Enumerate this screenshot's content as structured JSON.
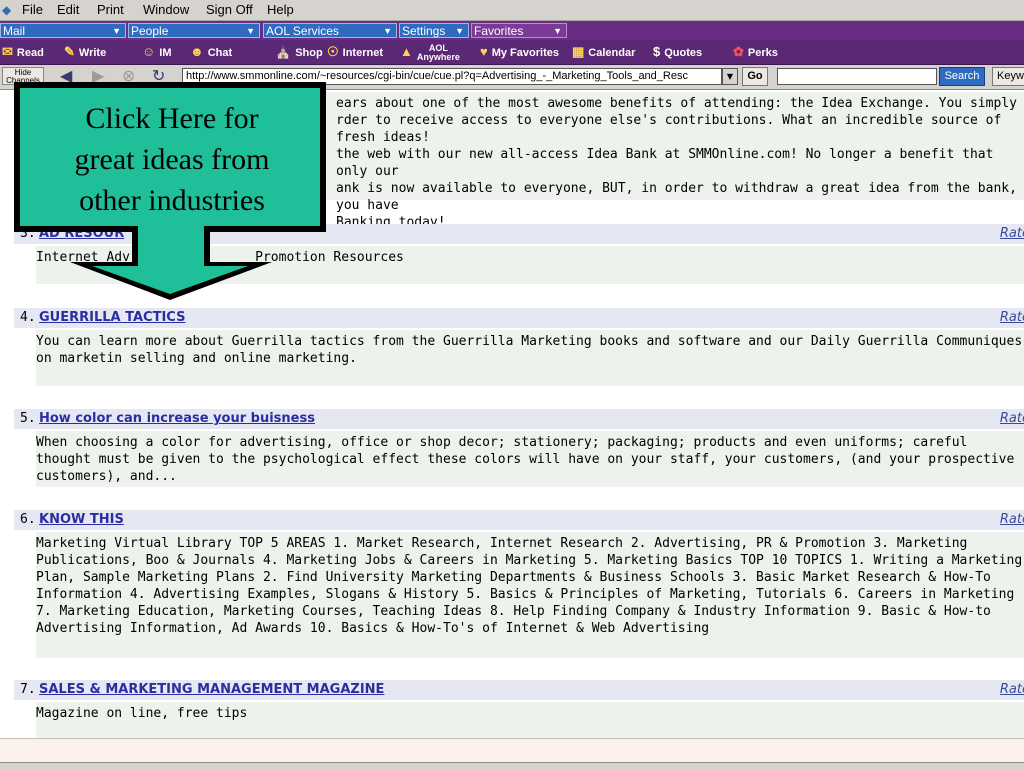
{
  "menu": [
    "File",
    "Edit",
    "Print",
    "Window",
    "Sign Off",
    "Help"
  ],
  "channels": [
    "Mail",
    "People",
    "AOL Services",
    "Settings",
    "Favorites"
  ],
  "toolbar": {
    "read": "Read",
    "write": "Write",
    "im": "IM",
    "chat": "Chat",
    "shop": "Shop",
    "internet": "Internet",
    "aol_anywhere_1": "AOL",
    "aol_anywhere_2": "Anywhere",
    "my_favorites": "My Favorites",
    "calendar": "Calendar",
    "quotes": "Quotes",
    "perks": "Perks"
  },
  "address": {
    "hide_channels_1": "Hide",
    "hide_channels_2": "Channels",
    "url": "http://www.smmonline.com/~resources/cgi-bin/cue/cue.pl?q=Advertising_-_Marketing_Tools_and_Resc",
    "go": "Go",
    "search": "Search",
    "keyword": "Keyw"
  },
  "intro_text": "ears about one of the most awesome benefits of attending: the Idea Exchange. You simply rder to receive access to everyone else's contributions. What an incredible source of fresh ideas! the web with our new all-access Idea Bank at SMMOnline.com! No longer a benefit that only our ank is now available to everyone, BUT, in order to withdraw a great idea from the bank, you have Banking today!",
  "intro_lines": [
    "ears about one of the most awesome benefits of attending: the Idea Exchange. You simply",
    "rder to receive access to everyone else's contributions. What an incredible source of fresh ideas!",
    "the web with our new all-access Idea Bank at SMMOnline.com! No longer a benefit that only our",
    "ank is now available to everyone, BUT, in order to withdraw a great idea from the bank, you have",
    "Banking today!"
  ],
  "rate_label": "Rate",
  "results": [
    {
      "num": "3.",
      "title": "AD RESOUR",
      "desc": "Internet Adv                Promotion Resources"
    },
    {
      "num": "4.",
      "title": "GUERRILLA TACTICS",
      "desc": "You can learn more about Guerrilla tactics from the Guerrilla Marketing books and software and our Daily Guerrilla Communiques on marketin selling and online marketing."
    },
    {
      "num": "5.",
      "title": "How color can increase your buisness",
      "desc": "When choosing a color for advertising, office or shop decor; stationery; packaging; products and even uniforms; careful thought must be given to the psychological effect these colors will have on your staff, your customers, (and your prospective customers), and..."
    },
    {
      "num": "6.",
      "title": "KNOW THIS",
      "desc": "Marketing Virtual Library TOP 5 AREAS 1. Market Research, Internet Research 2. Advertising, PR & Promotion 3. Marketing Publications, Boo & Journals 4. Marketing Jobs & Careers in Marketing 5. Marketing Basics TOP 10 TOPICS 1. Writing a Marketing Plan, Sample Marketing Plans 2. Find University Marketing Departments & Business Schools 3. Basic Market Research & How-To Information 4. Advertising Examples, Slogans & History 5. Basics & Principles of Marketing, Tutorials 6. Careers in Marketing 7. Marketing Education, Marketing Courses, Teaching Ideas 8. Help Finding Company & Industry Information 9. Basic & How-to Advertising Information, Ad Awards 10. Basics & How-To's of Internet & Web Advertising"
    },
    {
      "num": "7.",
      "title": "SALES & MARKETING MANAGEMENT MAGAZINE",
      "desc": "Magazine on line, free tips"
    }
  ],
  "callout": {
    "line1": "Click Here for",
    "line2": "great ideas from",
    "line3": "other industries"
  },
  "colors": {
    "callout_fill": "#1fbf9a",
    "toolbar_bg": "#5b2875",
    "link": "#2b2ea0"
  }
}
